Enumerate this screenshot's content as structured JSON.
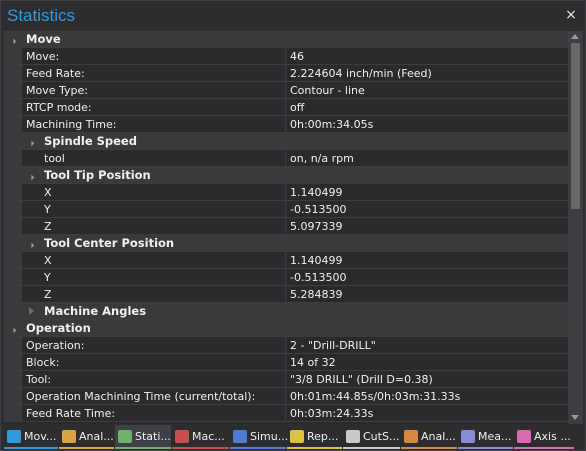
{
  "window": {
    "title": "Statistics"
  },
  "grid": {
    "move": {
      "label": "Move",
      "rows": [
        {
          "name": "Move:",
          "value": "46"
        },
        {
          "name": "Feed Rate:",
          "value": "2.224604 inch/min (Feed)"
        },
        {
          "name": "Move Type:",
          "value": "Contour - line"
        },
        {
          "name": "RTCP mode:",
          "value": "off"
        },
        {
          "name": "Machining Time:",
          "value": "0h:00m:34.05s"
        }
      ],
      "spindle_speed": {
        "label": "Spindle Speed",
        "rows": [
          {
            "name": "tool",
            "value": "on, n/a rpm"
          }
        ]
      },
      "tool_tip_position": {
        "label": "Tool Tip Position",
        "rows": [
          {
            "name": "X",
            "value": "1.140499"
          },
          {
            "name": "Y",
            "value": "-0.513500"
          },
          {
            "name": "Z",
            "value": "5.097339"
          }
        ]
      },
      "tool_center_position": {
        "label": "Tool Center Position",
        "rows": [
          {
            "name": "X",
            "value": "1.140499"
          },
          {
            "name": "Y",
            "value": "-0.513500"
          },
          {
            "name": "Z",
            "value": "5.284839"
          }
        ]
      },
      "machine_angles": {
        "label": "Machine Angles"
      }
    },
    "operation": {
      "label": "Operation",
      "rows": [
        {
          "name": "Operation:",
          "value": "2 - \"Drill-DRILL\""
        },
        {
          "name": "Block:",
          "value": "14 of 32"
        },
        {
          "name": "Tool:",
          "value": "\"3/8 DRILL\" (Drill D=0.38)"
        },
        {
          "name": "Operation Machining Time (current/total):",
          "value": "0h:01m:44.85s/0h:03m:31.33s"
        },
        {
          "name": "Feed Rate Time:",
          "value": "0h:03m:24.33s"
        }
      ]
    }
  },
  "tabs": [
    {
      "label": "Mov...",
      "icon": "move-list-icon",
      "color": "#2f9bde"
    },
    {
      "label": "Anal...",
      "icon": "analysis-icon",
      "color": "#d9a441"
    },
    {
      "label": "Stati...",
      "icon": "statistics-icon",
      "color": "#6bb36b",
      "active": true
    },
    {
      "label": "Mac...",
      "icon": "machine-icon",
      "color": "#c94f4f"
    },
    {
      "label": "Simu...",
      "icon": "simulation-icon",
      "color": "#4f7bd9"
    },
    {
      "label": "Rep...",
      "icon": "report-icon",
      "color": "#d9c341"
    },
    {
      "label": "CutS...",
      "icon": "cut-settings-icon",
      "color": "#c9c9c9"
    },
    {
      "label": "Anal...",
      "icon": "analysis-icon",
      "color": "#d98841"
    },
    {
      "label": "Mea...",
      "icon": "measure-icon",
      "color": "#8a8ad9"
    },
    {
      "label": "Axis ...",
      "icon": "axis-icon",
      "color": "#d96bb0"
    }
  ]
}
